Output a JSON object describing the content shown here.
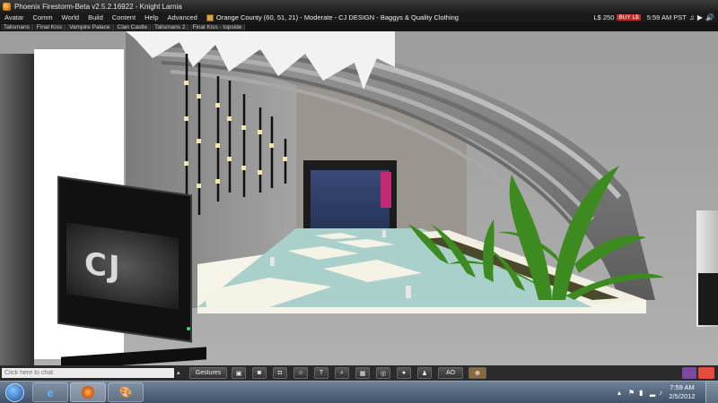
{
  "window": {
    "title": "Phoenix Firestorm-Beta v2.5.2.16922 - Knight Larnia"
  },
  "menubar": {
    "items": [
      "Avatar",
      "Comm",
      "World",
      "Build",
      "Content",
      "Help",
      "Advanced"
    ],
    "location": "Orange County (60, 51, 21) - Moderate - CJ DESIGN - Baggys & Quality Clothing",
    "balance": "L$ 250",
    "buy_label": "BUY L$",
    "time": "5:59 AM PST"
  },
  "favorites": [
    "Talismans",
    "Final Kiss",
    "Vampire Palace",
    "Clan Castle",
    "Talismans 2",
    "Final Kiss - topside"
  ],
  "scene": {
    "kiosk_logo": "CJ"
  },
  "chat": {
    "placeholder": "Click here to chat.",
    "gestures_label": "Gestures",
    "ao_label": "AO"
  },
  "taskbar": {
    "time": "7:59 AM",
    "date": "2/5/2012"
  },
  "colors": {
    "buy_button": "#c42b2b",
    "doorway_pink": "#c42a74",
    "pool_water": "#a9d0cb",
    "leaf_green": "#3d8a20"
  },
  "icons": {
    "toolbar": [
      "inventory-icon",
      "camera-icon",
      "snapshot-icon",
      "people-icon",
      "build-icon",
      "search-icon",
      "map-icon",
      "minimap-icon",
      "voice-icon",
      "appearance-icon"
    ]
  }
}
